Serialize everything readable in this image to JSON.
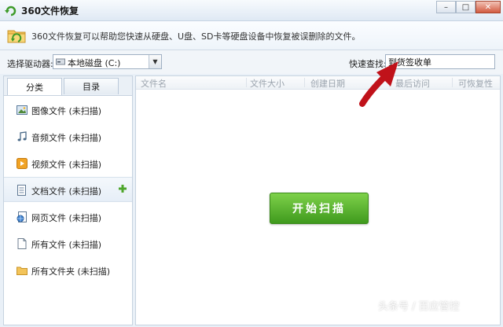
{
  "window": {
    "title": "360文件恢复",
    "controls": {
      "minimize": "–",
      "maximize": "□",
      "close": "✕"
    }
  },
  "info": {
    "text": "360文件恢复可以帮助您快速从硬盘、U盘、SD卡等硬盘设备中恢复被误删除的文件。"
  },
  "drive": {
    "label": "选择驱动器:",
    "selected": "本地磁盘 (C:)"
  },
  "search": {
    "label": "快速查找:",
    "value": "到货签收单"
  },
  "left_panel": {
    "tabs": [
      {
        "label": "分类"
      },
      {
        "label": "目录"
      }
    ],
    "categories": [
      {
        "label": "图像文件 (未扫描)",
        "icon": "image-icon"
      },
      {
        "label": "音频文件 (未扫描)",
        "icon": "music-icon"
      },
      {
        "label": "视频文件 (未扫描)",
        "icon": "video-icon"
      },
      {
        "label": "文档文件 (未扫描)",
        "icon": "document-icon"
      },
      {
        "label": "网页文件 (未扫描)",
        "icon": "webpage-icon"
      },
      {
        "label": "所有文件 (未扫描)",
        "icon": "file-icon"
      },
      {
        "label": "所有文件夹 (未扫描)",
        "icon": "folder-icon"
      }
    ]
  },
  "file_list": {
    "columns": [
      "文件名",
      "文件大小",
      "创建日期",
      "最后访问",
      "可恢复性"
    ]
  },
  "scan_button": {
    "label": "开始扫描"
  },
  "watermark": "头条号 / 百应管控",
  "colors": {
    "accent_green": "#4caf24",
    "annotation_red": "#c0121a"
  }
}
